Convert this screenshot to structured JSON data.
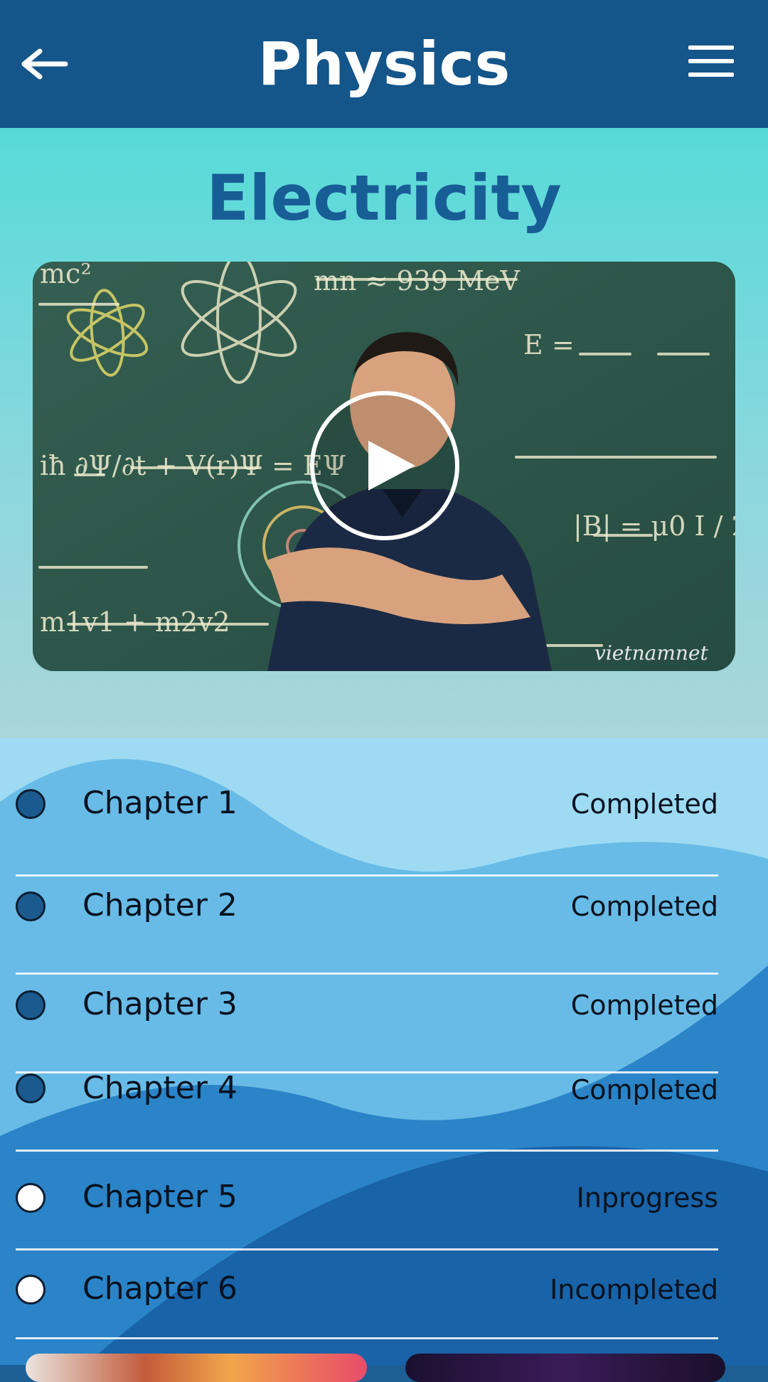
{
  "header": {
    "title": "Physics",
    "back_icon": "arrow-left-icon",
    "menu_icon": "hamburger-menu-icon",
    "background_color": "#14558a"
  },
  "lesson": {
    "title": "Electricity",
    "title_color": "#185e96",
    "video": {
      "play_icon": "play-icon",
      "watermark": "vietnamnet"
    }
  },
  "chapters": [
    {
      "name": "Chapter 1",
      "status": "Completed",
      "completed": true
    },
    {
      "name": "Chapter 2",
      "status": "Completed",
      "completed": true
    },
    {
      "name": "Chapter 3",
      "status": "Completed",
      "completed": true
    },
    {
      "name": "Chapter 4",
      "status": "Completed",
      "completed": true
    },
    {
      "name": "Chapter 5",
      "status": "Inprogress",
      "completed": false
    },
    {
      "name": "Chapter 6",
      "status": "Incompleted",
      "completed": false
    }
  ],
  "colors": {
    "completed_dot": "#1b5a8e",
    "pending_dot": "#ffffff"
  }
}
